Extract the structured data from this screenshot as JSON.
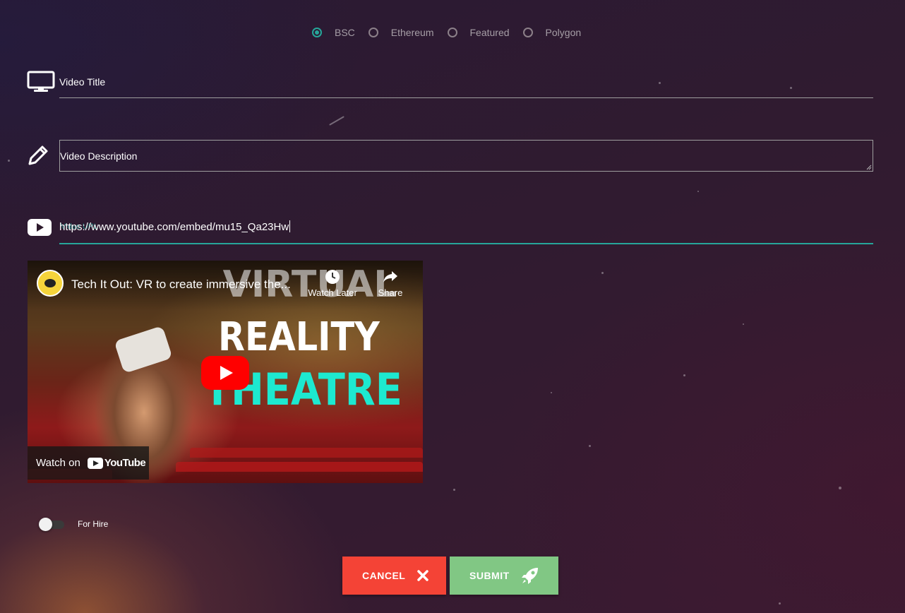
{
  "network": {
    "options": [
      "BSC",
      "Ethereum",
      "Featured",
      "Polygon"
    ],
    "selected": "BSC"
  },
  "form": {
    "title_label": "Video Title",
    "description_label": "Video Description",
    "url_value": "https://www.youtube.com/embed/mu15_Qa23Hw",
    "url_ghost_label": "Video URL"
  },
  "video": {
    "title": "Tech It Out: VR to create immersive the...",
    "watch_later_label": "Watch Later",
    "share_label": "Share",
    "thumbnail_line1": "VIRTUAL",
    "thumbnail_line2": "REALITY",
    "thumbnail_line3": "THEATRE",
    "watch_on_label": "Watch on",
    "youtube_brand": "YouTube"
  },
  "for_hire": {
    "label": "For Hire",
    "enabled": false
  },
  "actions": {
    "cancel_label": "CANCEL",
    "submit_label": "SUBMIT"
  },
  "colors": {
    "accent": "#26a69a",
    "cancel": "#f44336",
    "submit": "#81c784",
    "youtube_red": "#ff0000"
  },
  "icons": {
    "title": "monitor-icon",
    "description": "pencil-icon",
    "url": "youtube-icon",
    "cancel": "close-icon",
    "submit": "rocket-icon"
  }
}
